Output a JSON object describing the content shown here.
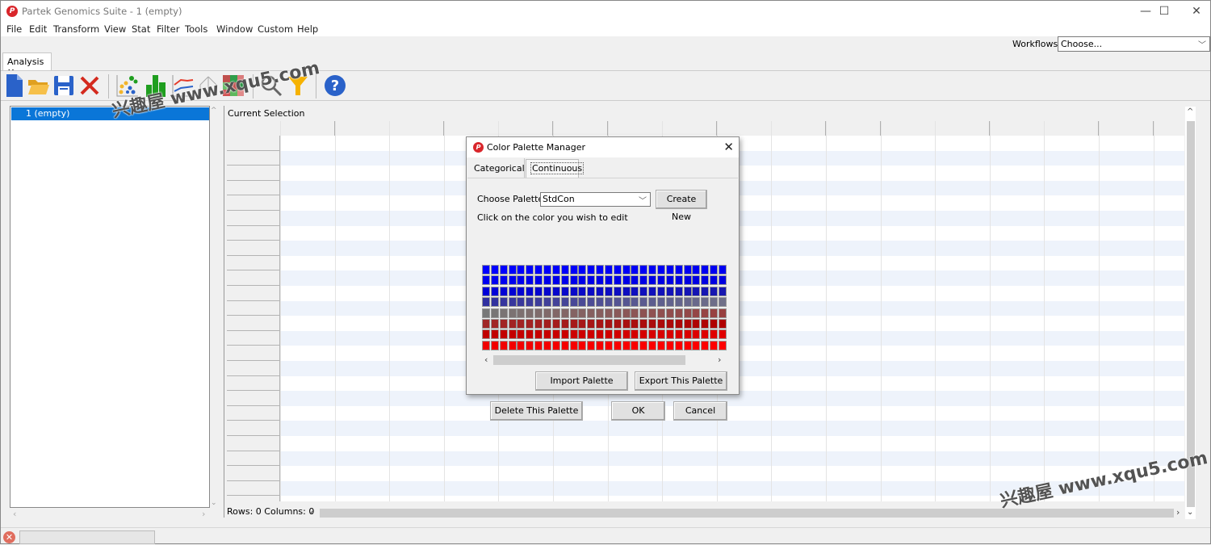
{
  "window": {
    "title": "Partek Genomics Suite - 1 (empty)",
    "logo_glyph": "P",
    "controls": {
      "minimize": "—",
      "maximize": "☐",
      "close": "✕"
    }
  },
  "menubar": [
    "File",
    "Edit",
    "Transform",
    "View",
    "Stat",
    "Filter",
    "Tools",
    "Window",
    "Custom",
    "Help"
  ],
  "workflows": {
    "label": "Workflows",
    "value": "Choose..."
  },
  "tabs": [
    {
      "label": "Analysis",
      "close": "✕"
    }
  ],
  "toolbar": {
    "buttons": [
      {
        "name": "new-file-icon",
        "color": "#2a62c9"
      },
      {
        "name": "open-folder-icon",
        "color": "#f6b732"
      },
      {
        "name": "save-icon",
        "color": "#2a62c9"
      },
      {
        "name": "delete-icon",
        "color": "#d42a1e"
      },
      {
        "name": "scatter-plot-icon",
        "color": "#f3b52a"
      },
      {
        "name": "bar-chart-icon",
        "color": "#1f9e1f"
      },
      {
        "name": "line-chart-icon",
        "color": "#e53b2a"
      },
      {
        "name": "tree-icon",
        "color": "#999999"
      },
      {
        "name": "heatmap-icon",
        "color": "#c0504d"
      },
      {
        "name": "search-icon",
        "color": "#666666"
      },
      {
        "name": "filter-icon",
        "color": "#f6b200"
      },
      {
        "name": "help-icon",
        "color": "#2a62c9"
      }
    ]
  },
  "left_panel": {
    "items": [
      {
        "label": "1 (empty)",
        "selected": true
      }
    ]
  },
  "main": {
    "current_selection_label": "Current Selection",
    "status": "Rows: 0 Columns: 0",
    "grid_rows": 25,
    "grid_cols": 17
  },
  "dialog": {
    "title": "Color Palette Manager",
    "tabs": [
      {
        "label": "Categorical",
        "active": false
      },
      {
        "label": "Continuous",
        "active": true
      }
    ],
    "choose_palette_label": "Choose Palette",
    "palette_value": "StdCon",
    "create_new": "Create New",
    "instruction": "Click on the color you wish to edit",
    "palette_rows": [
      {
        "from": "#0000ff",
        "to": "#0000f0"
      },
      {
        "from": "#0000f0",
        "to": "#0000e0"
      },
      {
        "from": "#0000d8",
        "to": "#1818b0"
      },
      {
        "from": "#3030a0",
        "to": "#707088"
      },
      {
        "from": "#787878",
        "to": "#984040"
      },
      {
        "from": "#a02828",
        "to": "#b00000"
      },
      {
        "from": "#c00000",
        "to": "#e00000"
      },
      {
        "from": "#f00000",
        "to": "#ff0000"
      }
    ],
    "palette_cols_visible": 28,
    "import": "Import Palette",
    "export": "Export This Palette",
    "delete": "Delete This Palette",
    "ok": "OK",
    "cancel": "Cancel"
  },
  "watermarks": [
    "兴趣屋 www.xqu5.com",
    "兴趣屋 www.xqu5.com"
  ]
}
